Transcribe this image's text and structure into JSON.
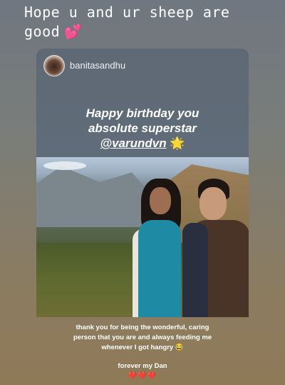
{
  "story": {
    "top_text": "Hope u and ur sheep are good",
    "top_emoji": "💕"
  },
  "shared_post": {
    "username": "banitasandhu",
    "headline_line1": "Happy birthday you",
    "headline_line2": "absolute superstar",
    "mention": "@varundvn",
    "headline_emoji": "🌟",
    "caption_lines": [
      "thank you for being the wonderful, caring",
      "person that you are and always feeding me",
      "whenever I got hangry"
    ],
    "caption_emoji": "😂",
    "signoff": "forever my Dan",
    "hearts": "❤️❤️❤️"
  },
  "colors": {
    "background_top": "#6f7780",
    "background_bottom": "#8f7a57",
    "card_bg": "#606c7a",
    "scarf_teal": "#1f8aa3"
  },
  "icons": [
    "avatar",
    "heart-emoji",
    "star-emoji",
    "laughing-emoji"
  ]
}
